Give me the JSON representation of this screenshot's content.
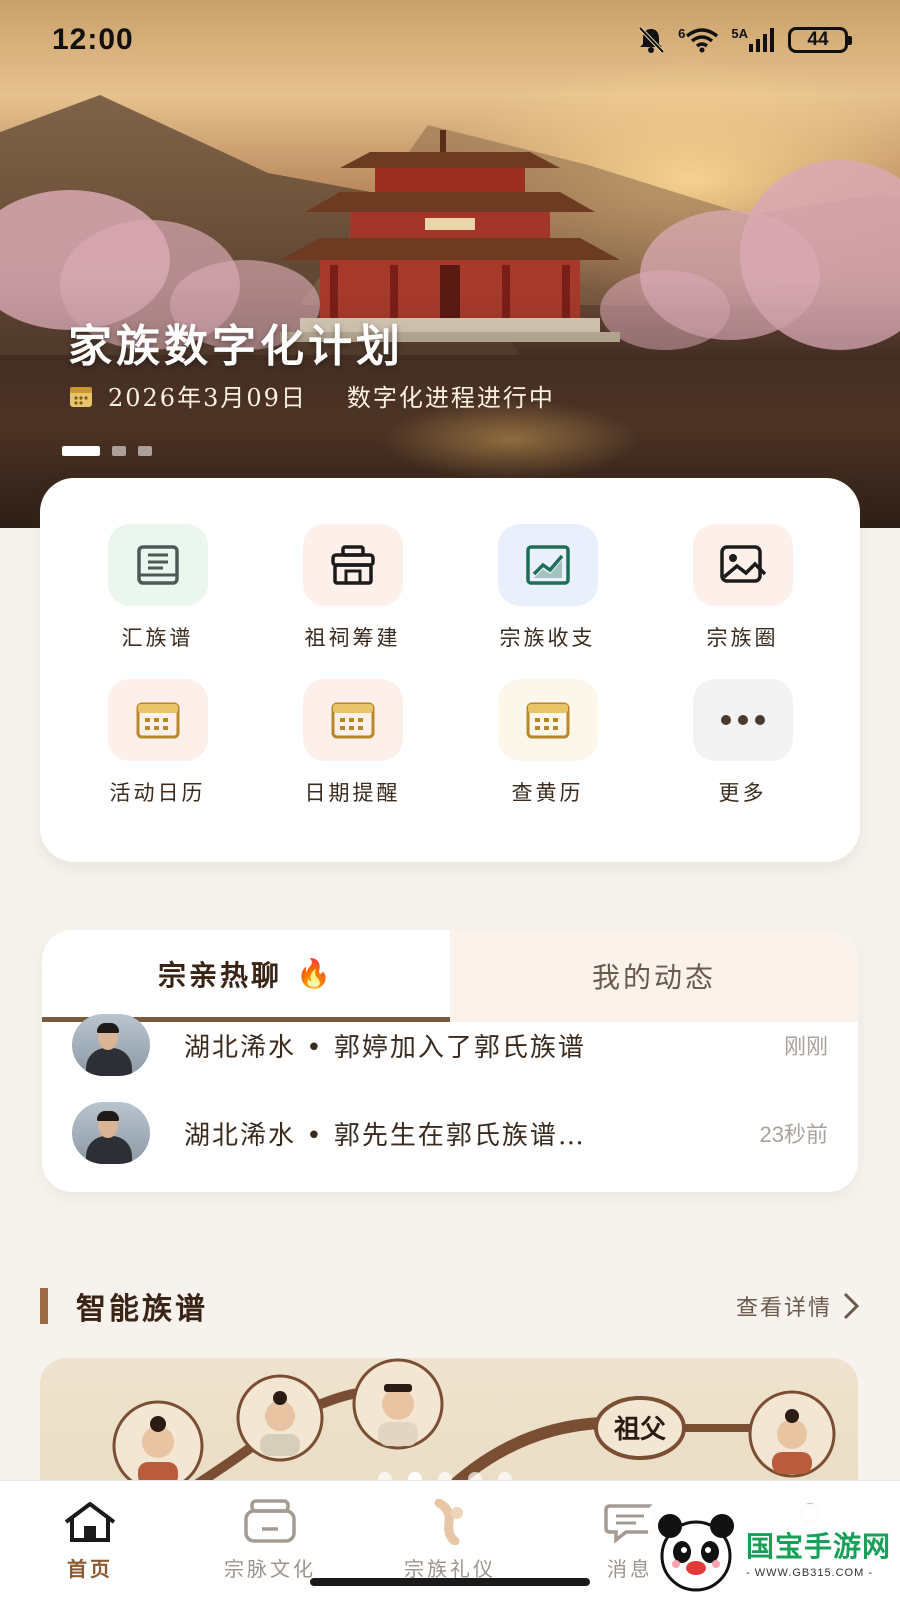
{
  "status_bar": {
    "time": "12:00",
    "network_label": "5A",
    "wifi_label": "6",
    "battery": "44"
  },
  "hero": {
    "title": "家族数字化计划",
    "date": "2026年3月09日",
    "status": "数字化进程进行中",
    "slides_total": 3,
    "slide_active": 1
  },
  "quick_grid": {
    "items": [
      {
        "label": "汇族谱",
        "icon": "book-icon",
        "bg": "#eaf6ee",
        "color": "#4c5a57"
      },
      {
        "label": "祖祠筹建",
        "icon": "shrine-icon",
        "bg": "#fdf0ea",
        "color": "#1b1b1b"
      },
      {
        "label": "宗族收支",
        "icon": "finance-chart-icon",
        "bg": "#eaf0fb",
        "color": "#1f6e57"
      },
      {
        "label": "宗族圈",
        "icon": "photo-icon",
        "bg": "#fdf0ea",
        "color": "#1b1b1b"
      },
      {
        "label": "活动日历",
        "icon": "calendar-icon",
        "bg": "#fdf0ea",
        "color": "#b8862b"
      },
      {
        "label": "日期提醒",
        "icon": "calendar-icon",
        "bg": "#fdf0ea",
        "color": "#b8862b"
      },
      {
        "label": "查黄历",
        "icon": "calendar-icon",
        "bg": "#fdf6ea",
        "color": "#b8862b"
      },
      {
        "label": "更多",
        "icon": "more-dots-icon",
        "bg": "#f3f3f3",
        "color": "#4a3a2e"
      }
    ]
  },
  "feed": {
    "tabs": [
      {
        "label": "宗亲热聊",
        "emoji": "🔥"
      },
      {
        "label": "我的动态"
      }
    ],
    "rows": [
      {
        "text": "湖北浠水 • 郭婷加入了郭氏族谱",
        "time": "刚刚"
      },
      {
        "text": "湖北浠水 • 郭先生在郭氏族谱…",
        "time": "23秒前"
      }
    ]
  },
  "section": {
    "title": "智能族谱",
    "link": "查看详情"
  },
  "tree_card": {
    "label": "祖父",
    "slides_total": 5,
    "slide_active": 2
  },
  "bottom_nav": {
    "items": [
      {
        "label": "首页",
        "icon": "home-icon",
        "active": true
      },
      {
        "label": "宗脉文化",
        "icon": "culture-icon",
        "active": false
      },
      {
        "label": "宗族礼仪",
        "icon": "etiquette-icon",
        "active": false
      },
      {
        "label": "消息",
        "icon": "message-icon",
        "active": false
      }
    ]
  },
  "watermark": {
    "title": "国宝手游网",
    "url": "- WWW.GB315.COM -"
  },
  "colors": {
    "accent": "#8a5a30",
    "section_bar": "#9a6b42",
    "page_bg": "#f6f3ee",
    "calendar_icon": "#b8862b"
  }
}
